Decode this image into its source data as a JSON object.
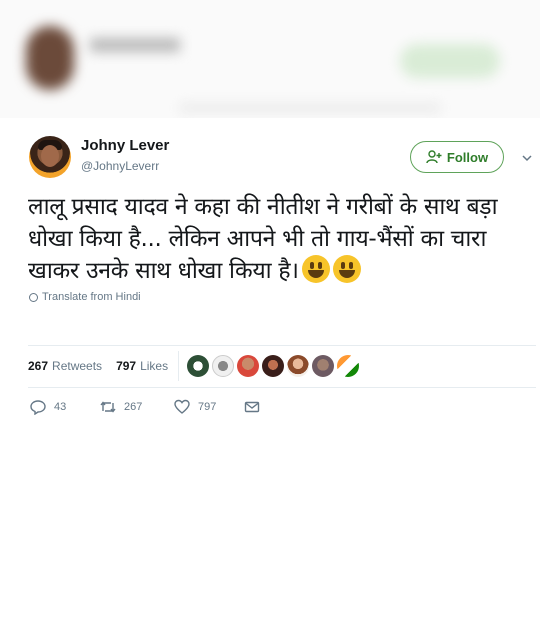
{
  "tweet": {
    "author_name": "Johny Lever",
    "author_handle": "@JohnyLeverr",
    "follow_label": "Follow",
    "text": "लालू प्रसाद यादव ने कहा की नीतीश ने गरीबों के साथ बड़ा धोखा किया है... लेकिन आपने भी तो गाय-भैंसों का चारा खाकर उनके साथ धोखा किया है।",
    "translate_label": "Translate from Hindi",
    "retweets_count": "267",
    "retweets_label": "Retweets",
    "likes_count": "797",
    "likes_label": "Likes",
    "reply_count": "43",
    "retweet_action_count": "267",
    "like_action_count": "797"
  },
  "icons": {
    "follow": "add-user-icon",
    "caret": "chevron-down-icon",
    "translate": "globe-icon",
    "reply": "reply-icon",
    "retweet": "retweet-icon",
    "like": "heart-icon",
    "message": "envelope-icon"
  },
  "colors": {
    "follow_accent": "#2f7d2a",
    "secondary_text": "#657786",
    "primary_text": "#14171a",
    "emoji": "#f7c42a"
  }
}
